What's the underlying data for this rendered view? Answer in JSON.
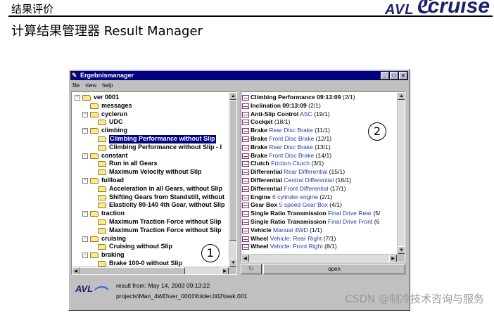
{
  "slide": {
    "title": "结果评价",
    "subtitle": "计算结果管理器 Result Manager",
    "brand_avl": "AVL",
    "brand_product": "cruise"
  },
  "window": {
    "title": "Ergebnismanager",
    "controls": [
      "_",
      "□",
      "×"
    ],
    "menu": [
      "file",
      "view",
      "help"
    ]
  },
  "tree": {
    "rows": [
      {
        "level": 0,
        "type": "folder",
        "expand": "-",
        "label": "ver 0001"
      },
      {
        "level": 1,
        "type": "folder",
        "expand": "",
        "label": "messages"
      },
      {
        "level": 1,
        "type": "folder",
        "expand": "-",
        "label": "cyclerun"
      },
      {
        "level": 2,
        "type": "folder",
        "expand": "",
        "label": "UDC"
      },
      {
        "level": 1,
        "type": "folder",
        "expand": "-",
        "label": "climbing"
      },
      {
        "level": 2,
        "type": "folder",
        "expand": "",
        "label": "Climbing Performance without Slip",
        "selected": true
      },
      {
        "level": 2,
        "type": "folder",
        "expand": "",
        "label": "Climbing Performance without Slip - I"
      },
      {
        "level": 1,
        "type": "folder",
        "expand": "-",
        "label": "constant"
      },
      {
        "level": 2,
        "type": "folder",
        "expand": "",
        "label": "Run in all Gears"
      },
      {
        "level": 2,
        "type": "folder",
        "expand": "",
        "label": "Maximum Velocity without Slip"
      },
      {
        "level": 1,
        "type": "folder",
        "expand": "-",
        "label": "fullload"
      },
      {
        "level": 2,
        "type": "folder",
        "expand": "",
        "label": "Acceleration in all Gears, without Slip"
      },
      {
        "level": 2,
        "type": "folder",
        "expand": "",
        "label": "Shifting Gears from Standstill, without"
      },
      {
        "level": 2,
        "type": "folder",
        "expand": "",
        "label": "Elasticity 80-140 4th Gear, without Slip"
      },
      {
        "level": 1,
        "type": "folder",
        "expand": "-",
        "label": "traction"
      },
      {
        "level": 2,
        "type": "folder",
        "expand": "",
        "label": "Maximum Traction Force without Slip"
      },
      {
        "level": 2,
        "type": "folder",
        "expand": "",
        "label": "Maximum Traction Force without Slip"
      },
      {
        "level": 1,
        "type": "folder",
        "expand": "-",
        "label": "cruising"
      },
      {
        "level": 2,
        "type": "folder",
        "expand": "",
        "label": "Cruising without Slip"
      },
      {
        "level": 1,
        "type": "folder",
        "expand": "-",
        "label": "braking"
      },
      {
        "level": 2,
        "type": "folder",
        "expand": "",
        "label": "Brake 100-0 without Slip"
      }
    ]
  },
  "results": {
    "rows": [
      {
        "bold": "Climbing Performance 09:13:09",
        "blue": "",
        "count": "(2/1)"
      },
      {
        "bold": "Inclination 09:13:09",
        "blue": "",
        "count": "(2/1)"
      },
      {
        "bold": "Anti-Slip Control",
        "blue": "ASC",
        "count": "(19/1)"
      },
      {
        "bold": "Cockpit",
        "blue": "",
        "count": "(18/1)"
      },
      {
        "bold": "Brake",
        "blue": "Rear Disc Brake",
        "count": "(11/1)"
      },
      {
        "bold": "Brake",
        "blue": "Front Disc Brake",
        "count": "(12/1)"
      },
      {
        "bold": "Brake",
        "blue": "Rear Disc Brake",
        "count": "(13/1)"
      },
      {
        "bold": "Brake",
        "blue": "Front Disc Brake",
        "count": "(14/1)"
      },
      {
        "bold": "Clutch",
        "blue": "Friction Clutch",
        "count": "(3/1)"
      },
      {
        "bold": "Differential",
        "blue": "Rear Differential",
        "count": "(15/1)"
      },
      {
        "bold": "Differential",
        "blue": "Central Differential",
        "count": "(16/1)"
      },
      {
        "bold": "Differential",
        "blue": "Front Differential",
        "count": "(17/1)"
      },
      {
        "bold": "Engine",
        "blue": "6 cylinder engine",
        "count": "(2/1)"
      },
      {
        "bold": "Gear Box",
        "blue": "5 speed Gear Box",
        "count": "(4/1)"
      },
      {
        "bold": "Single Ratio Transmission",
        "blue": "Final Drive Rear",
        "count": "(5/"
      },
      {
        "bold": "Single Ratio Transmission",
        "blue": "Final Drive Front",
        "count": "(6"
      },
      {
        "bold": "Vehicle",
        "blue": "Manual 4WD",
        "count": "(1/1)"
      },
      {
        "bold": "Wheel",
        "blue": "Vehicle: Rear Right",
        "count": "(7/1)"
      },
      {
        "bold": "Wheel",
        "blue": "Vehicle: Front Right",
        "count": "(8/1)"
      }
    ]
  },
  "buttons": {
    "refresh_icon": "refresh-icon",
    "open_label": "open"
  },
  "status": {
    "result_from": "result from: May 14, 2003 09:13:22",
    "path": "projects\\Man_4WD\\ver_0001\\folder.002\\task.001",
    "logo_text": "AVL"
  },
  "markers": {
    "one": "1",
    "two": "2"
  },
  "watermark": "CSDN @制冷技术咨询与服务"
}
